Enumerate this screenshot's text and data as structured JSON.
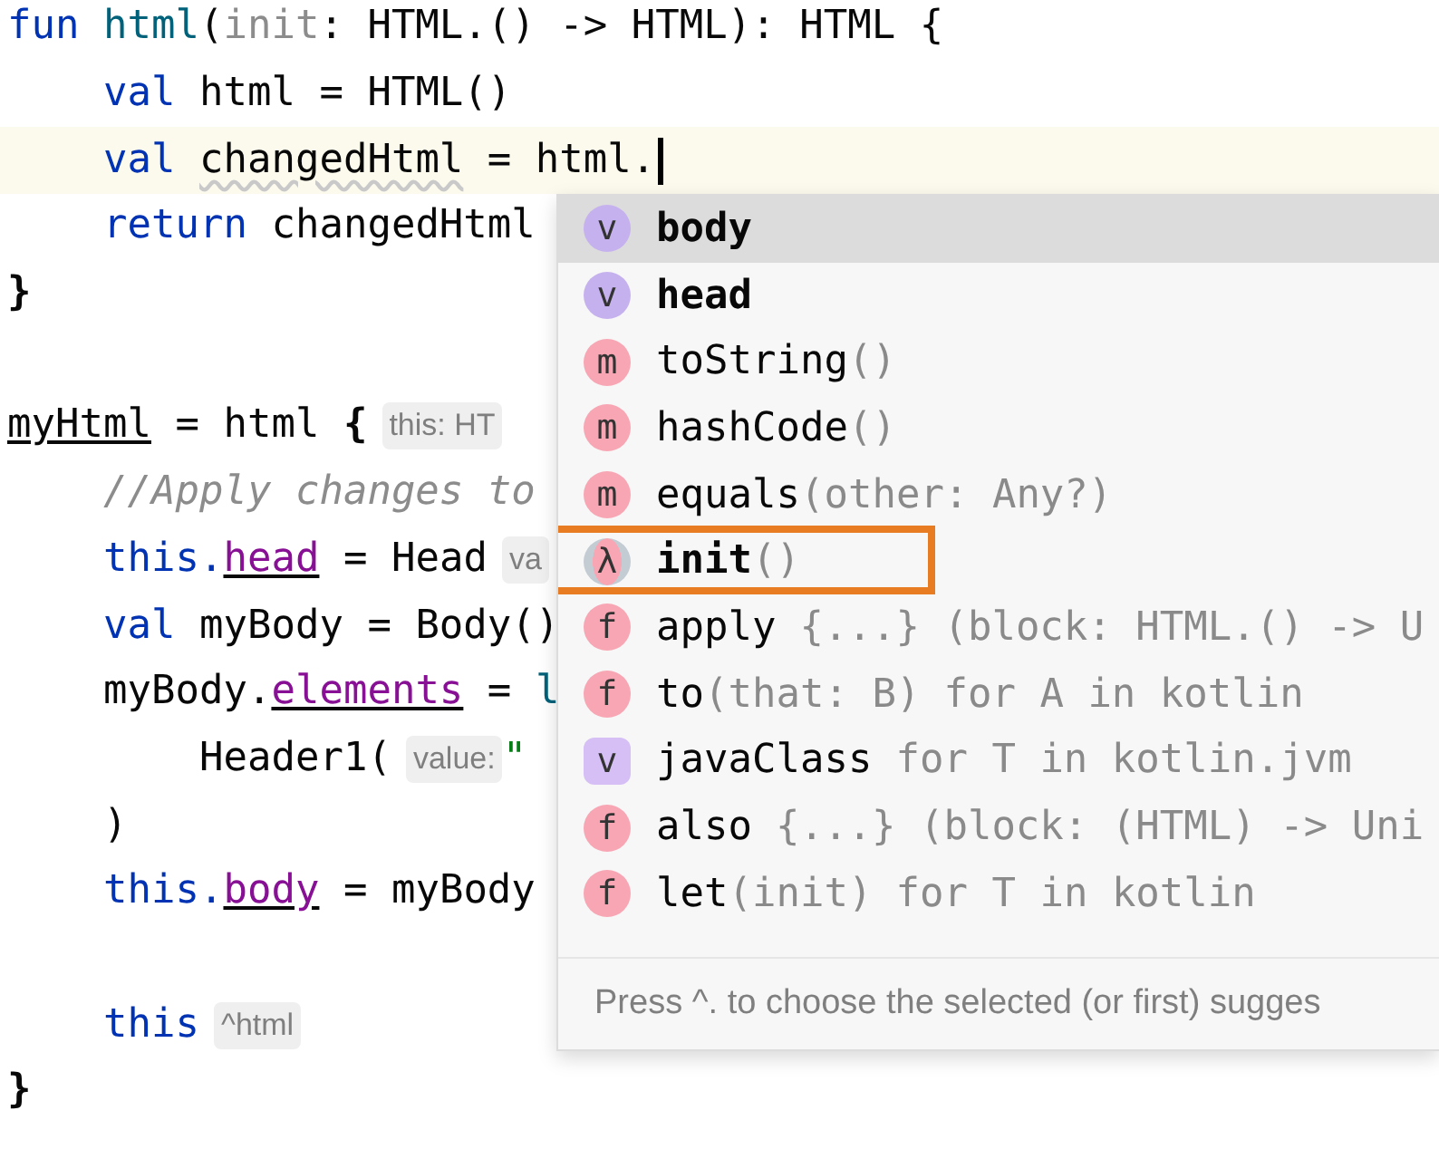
{
  "editor": {
    "lines": [
      {
        "kind": "code",
        "tokens": [
          {
            "kind": "keyword",
            "text": "fun "
          },
          {
            "kind": "function",
            "text": "html"
          },
          {
            "kind": "plain",
            "text": "("
          },
          {
            "kind": "param",
            "text": "init"
          },
          {
            "kind": "plain",
            "text": ": HTML.() -> HTML): HTML {"
          }
        ],
        "children": [
          {
            "kind": "code",
            "tokens": [
              {
                "kind": "keyword",
                "text": "val "
              },
              {
                "kind": "plain",
                "text": "html = HTML()"
              }
            ]
          },
          {
            "kind": "code",
            "current": true,
            "caret": true,
            "tokens": [
              {
                "kind": "keyword",
                "text": "val "
              },
              {
                "kind": "warning",
                "text": "changedHtml"
              },
              {
                "kind": "plain",
                "text": " = html."
              }
            ]
          },
          {
            "kind": "code",
            "tokens": [
              {
                "kind": "keyword",
                "text": "return "
              },
              {
                "kind": "plain",
                "text": "changedHtml"
              }
            ]
          }
        ]
      },
      {
        "kind": "code",
        "tokens": [
          {
            "kind": "brace",
            "text": "}"
          }
        ]
      },
      {
        "kind": "blank"
      },
      {
        "kind": "code",
        "tokens": [
          {
            "kind": "underlined",
            "text": "myHtml"
          },
          {
            "kind": "plain",
            "text": " = html "
          },
          {
            "kind": "brace",
            "text": "{"
          },
          {
            "kind": "hint",
            "text": "this: HT"
          }
        ],
        "children": [
          {
            "kind": "code",
            "tokens": [
              {
                "kind": "comment",
                "text": "//Apply changes to"
              }
            ]
          },
          {
            "kind": "code",
            "tokens": [
              {
                "kind": "keyword",
                "text": "this."
              },
              {
                "kind": "property",
                "text": "head"
              },
              {
                "kind": "plain",
                "text": " = Head"
              },
              {
                "kind": "hint",
                "text": "va"
              }
            ]
          },
          {
            "kind": "code",
            "tokens": [
              {
                "kind": "keyword",
                "text": "val "
              },
              {
                "kind": "plain",
                "text": "myBody = Body()"
              }
            ]
          },
          {
            "kind": "code",
            "tokens": [
              {
                "kind": "plain",
                "text": "myBody."
              },
              {
                "kind": "property",
                "text": "elements"
              },
              {
                "kind": "plain",
                "text": " = "
              },
              {
                "kind": "function",
                "text": "l"
              }
            ],
            "children": [
              {
                "kind": "code",
                "tokens": [
                  {
                    "kind": "plain",
                    "text": "Header1("
                  },
                  {
                    "kind": "hint",
                    "text": "value:"
                  },
                  {
                    "kind": "string",
                    "text": "\""
                  }
                ]
              }
            ]
          },
          {
            "kind": "code",
            "tokens": [
              {
                "kind": "plain",
                "text": ")"
              }
            ]
          },
          {
            "kind": "code",
            "tokens": [
              {
                "kind": "keyword",
                "text": "this."
              },
              {
                "kind": "property",
                "text": "body"
              },
              {
                "kind": "plain",
                "text": " = myBody"
              }
            ]
          },
          {
            "kind": "blank"
          },
          {
            "kind": "code",
            "tokens": [
              {
                "kind": "keyword",
                "text": "this"
              },
              {
                "kind": "hint",
                "text": "^html"
              }
            ]
          }
        ]
      },
      {
        "kind": "code",
        "tokens": [
          {
            "kind": "brace",
            "text": "}"
          }
        ]
      }
    ]
  },
  "completion": {
    "items": [
      {
        "icon": "v",
        "kind": "property",
        "name": "body",
        "bold": true,
        "selected": true
      },
      {
        "icon": "v",
        "kind": "property",
        "name": "head",
        "bold": true,
        "selected": false
      },
      {
        "icon": "m",
        "kind": "method",
        "name": "toString",
        "bold": false,
        "params": "()",
        "selected": false
      },
      {
        "icon": "m",
        "kind": "method",
        "name": "hashCode",
        "bold": false,
        "params": "()",
        "selected": false
      },
      {
        "icon": "m",
        "kind": "method",
        "name": "equals",
        "bold": false,
        "params": "(other: Any?)",
        "selected": false
      },
      {
        "icon": "λ",
        "kind": "lambda",
        "name": "init",
        "bold": true,
        "params": "()",
        "selected": false,
        "highlighted": true
      },
      {
        "icon": "f",
        "kind": "function",
        "name": "apply",
        "bold": false,
        "detail": "{...} (block: HTML.() -> U",
        "selected": false
      },
      {
        "icon": "f",
        "kind": "function",
        "name": "to",
        "bold": false,
        "params": "(that: B)",
        "detail": "for A in kotlin",
        "selected": false
      },
      {
        "icon": "v",
        "kind": "extension",
        "name": "javaClass",
        "bold": false,
        "detail": "for T in kotlin.jvm",
        "selected": false
      },
      {
        "icon": "f",
        "kind": "function",
        "name": "also",
        "bold": false,
        "detail": "{...} (block: (HTML) -> Uni",
        "selected": false
      },
      {
        "icon": "f",
        "kind": "function",
        "name": "let",
        "bold": false,
        "params": "(init)",
        "detail": "for T in kotlin",
        "selected": false
      }
    ],
    "footer": "Press ^. to choose the selected (or first) sugges"
  }
}
